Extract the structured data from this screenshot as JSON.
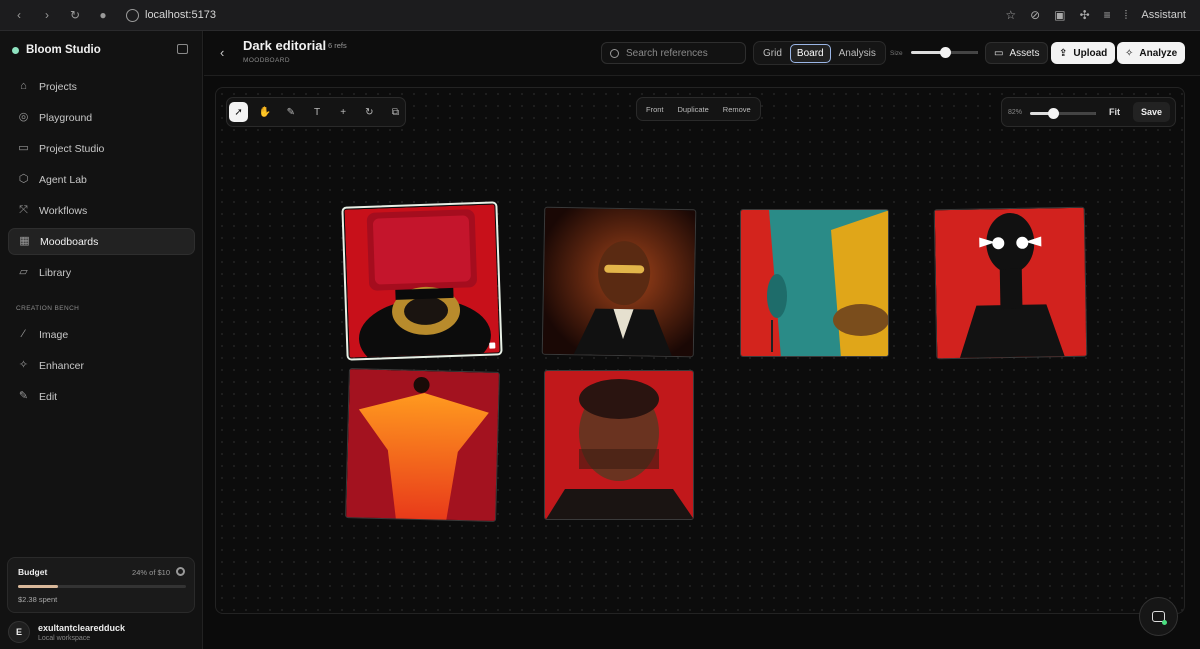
{
  "browser": {
    "url": "localhost:5173",
    "assistant_label": "Assistant"
  },
  "sidebar": {
    "brand": "Bloom Studio",
    "items": [
      {
        "label": "Projects",
        "icon": "home-icon"
      },
      {
        "label": "Playground",
        "icon": "compass-icon"
      },
      {
        "label": "Project Studio",
        "icon": "briefcase-icon"
      },
      {
        "label": "Agent Lab",
        "icon": "hexagon-icon"
      },
      {
        "label": "Workflows",
        "icon": "workflow-icon"
      },
      {
        "label": "Moodboards",
        "icon": "image-board-icon",
        "active": true
      },
      {
        "label": "Library",
        "icon": "folder-icon"
      }
    ],
    "section_label": "CREATION BENCH",
    "bench_items": [
      {
        "label": "Image",
        "icon": "wand-icon"
      },
      {
        "label": "Enhancer",
        "icon": "sparkle-icon"
      },
      {
        "label": "Edit",
        "icon": "pencil-icon"
      }
    ],
    "budget": {
      "title": "Budget",
      "percent_text": "24% of $10",
      "progress": 0.24,
      "spent": "$2.38 spent"
    },
    "user": {
      "initial": "E",
      "name": "exultantclearedduck",
      "subtitle": "Local workspace"
    }
  },
  "header": {
    "title": "Dark editorial",
    "refs": "6 refs",
    "subtitle": "MOODBOARD",
    "search_placeholder": "Search references",
    "views": [
      "Grid",
      "Board",
      "Analysis"
    ],
    "active_view": "Board",
    "size_label": "Size",
    "size_value": 0.5,
    "assets_label": "Assets",
    "upload_label": "Upload",
    "analyze_label": "Analyze"
  },
  "canvas": {
    "context_actions": [
      "Front",
      "Duplicate",
      "Remove"
    ],
    "zoom_text": "82%",
    "zoom_value": 0.35,
    "fit_label": "Fit",
    "save_label": "Save",
    "tools": [
      "select-icon",
      "hand-icon",
      "note-icon",
      "text-icon",
      "plus-icon",
      "rotate-icon",
      "frame-icon"
    ]
  },
  "colors": {
    "accent_selected": "#9bb6e6",
    "budget_fill": "#d9b89a",
    "status_green": "#4ade80",
    "brand_dot": "#8fe3c0"
  }
}
